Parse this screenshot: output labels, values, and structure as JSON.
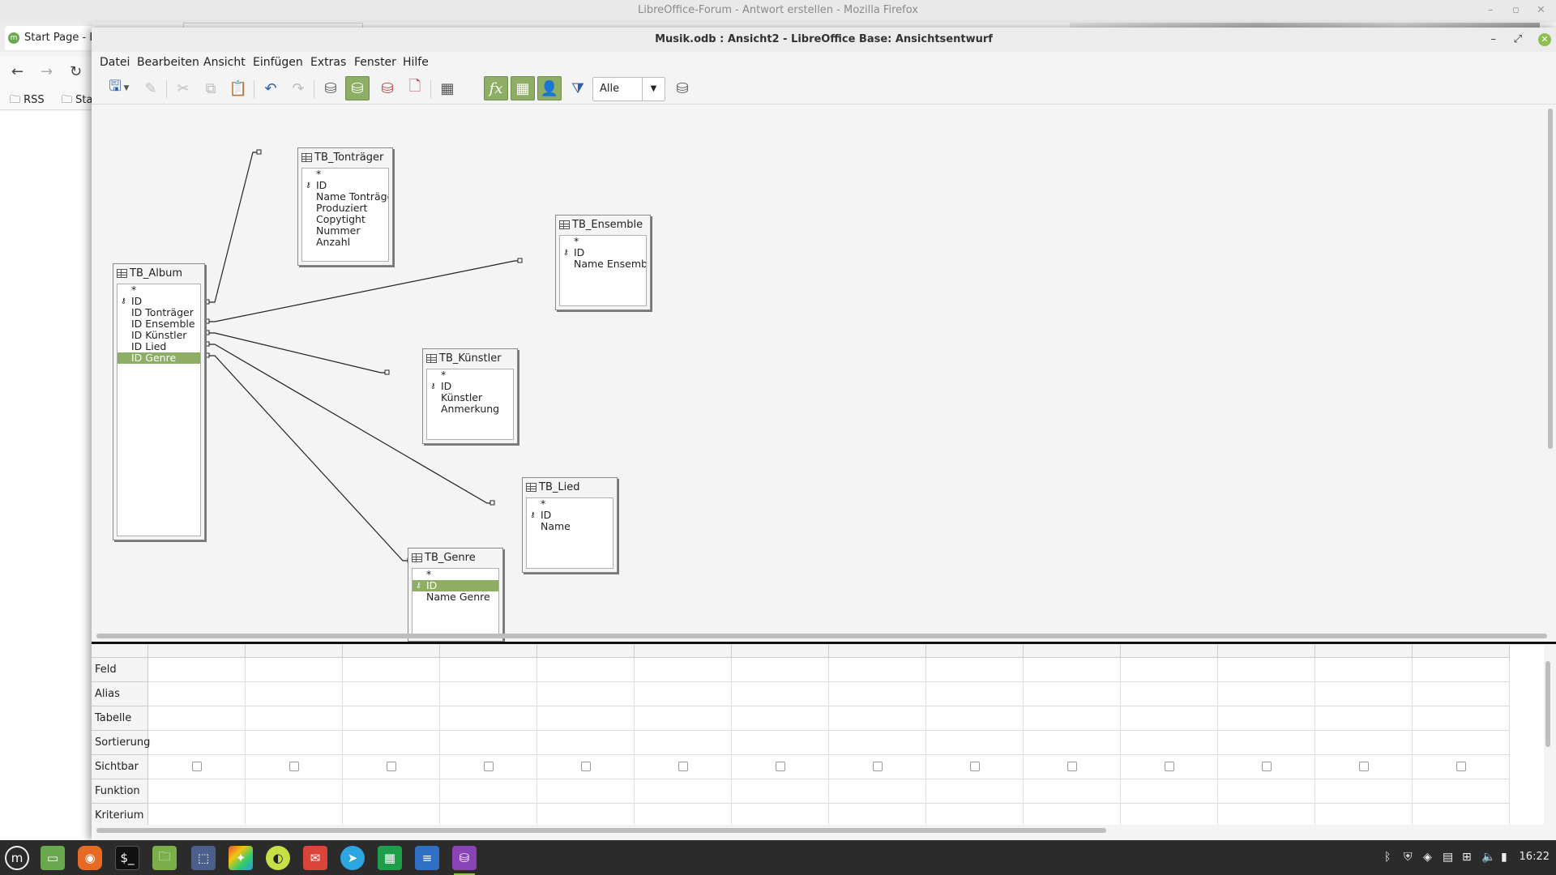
{
  "firefox": {
    "title": "LibreOffice-Forum - Antwort erstellen - Mozilla Firefox",
    "tab_label": "Start Page - Li",
    "bookmarks": [
      "RSS",
      "Sta"
    ]
  },
  "window": {
    "title": "Musik.odb : Ansicht2 - LibreOffice Base: Ansichtsentwurf"
  },
  "menu": [
    "Datei",
    "Bearbeiten",
    "Ansicht",
    "Einfügen",
    "Extras",
    "Fenster",
    "Hilfe"
  ],
  "toolbar": {
    "filter_value": "Alle"
  },
  "tables": {
    "album": {
      "name": "TB_Album",
      "fields": [
        "*",
        "ID",
        "ID Tonträger",
        "ID Ensemble",
        "ID Künstler",
        "ID Lied",
        "ID Genre"
      ]
    },
    "tontraeger": {
      "name": "TB_Tonträger",
      "fields": [
        "*",
        "ID",
        "Name Tonträger",
        "Produziert",
        "Copytight",
        "Nummer",
        "Anzahl"
      ]
    },
    "ensemble": {
      "name": "TB_Ensemble",
      "fields": [
        "*",
        "ID",
        "Name Ensemble"
      ]
    },
    "kuenstler": {
      "name": "TB_Künstler",
      "fields": [
        "*",
        "ID",
        "Künstler",
        "Anmerkung"
      ]
    },
    "lied": {
      "name": "TB_Lied",
      "fields": [
        "*",
        "ID",
        "Name"
      ]
    },
    "genre": {
      "name": "TB_Genre",
      "fields": [
        "*",
        "ID",
        "Name Genre"
      ]
    }
  },
  "grid": {
    "rows": [
      "Feld",
      "Alias",
      "Tabelle",
      "Sortierung",
      "Sichtbar",
      "Funktion",
      "Kriterium"
    ]
  },
  "tray": {
    "clock": "16:22"
  }
}
